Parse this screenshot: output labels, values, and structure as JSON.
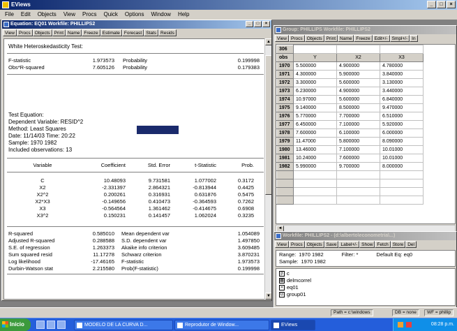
{
  "app": {
    "title": "EViews",
    "menu": [
      "File",
      "Edit",
      "Objects",
      "View",
      "Procs",
      "Quick",
      "Options",
      "Window",
      "Help"
    ]
  },
  "equation_window": {
    "title": "Equation: EQ01   Workfile: PHILLIPS2",
    "toolbar": [
      "View",
      "Procs",
      "Objects",
      "Print",
      "Name",
      "Freeze",
      "Estimate",
      "Forecast",
      "Stats",
      "Resids"
    ],
    "test_title": "White Heteroskedasticity Test:",
    "summary": [
      {
        "label": "F-statistic",
        "value": "1.973573",
        "plabel": "Probability",
        "pvalue": "0.199998"
      },
      {
        "label": "Obs*R-squared",
        "value": "7.605126",
        "plabel": "Probability",
        "pvalue": "0.179383"
      }
    ],
    "info": [
      "Test Equation:",
      "Dependent Variable: RESID^2",
      "Method: Least Squares",
      "Date: 11/14/03   Time: 20:22",
      "Sample: 1970 1982",
      "Included observations: 13"
    ],
    "coef_headers": [
      "Variable",
      "Coefficient",
      "Std. Error",
      "t-Statistic",
      "Prob."
    ],
    "coef_rows": [
      [
        "C",
        "10.48093",
        "9.731581",
        "1.077002",
        "0.3172"
      ],
      [
        "X2",
        "-2.331397",
        "2.864321",
        "-0.813944",
        "0.4425"
      ],
      [
        "X2^2",
        "0.200261",
        "0.316931",
        "0.631876",
        "0.5475"
      ],
      [
        "X2*X3",
        "-0.149656",
        "0.410473",
        "-0.364593",
        "0.7262"
      ],
      [
        "X3",
        "-0.564564",
        "1.361462",
        "-0.414675",
        "0.6908"
      ],
      [
        "X3^2",
        "0.150231",
        "0.141457",
        "1.062024",
        "0.3235"
      ]
    ],
    "stats": [
      [
        "R-squared",
        "0.585010",
        "Mean dependent var",
        "1.054089"
      ],
      [
        "Adjusted R-squared",
        "0.288588",
        "S.D. dependent var",
        "1.497850"
      ],
      [
        "S.E. of regression",
        "1.263373",
        "Akaike info criterion",
        "3.609485"
      ],
      [
        "Sum squared resid",
        "11.17278",
        "Schwarz criterion",
        "3.870231"
      ],
      [
        "Log likelihood",
        "-17.46165",
        "F-statistic",
        "1.973573"
      ],
      [
        "Durbin-Watson stat",
        "2.215580",
        "Prob(F-statistic)",
        "0.199998"
      ]
    ]
  },
  "group_window": {
    "title": "Group: PHILLIPS   Workfile: PHILLIPS2",
    "toolbar": [
      "View",
      "Procs",
      "Objects",
      "Print",
      "Name",
      "Freeze",
      "Edit+/-",
      "Smpl+/-",
      "In"
    ],
    "cell_ref": "306",
    "headers": [
      "obs",
      "Y",
      "X2",
      "X3"
    ],
    "rows": [
      [
        "1970",
        "5.500000",
        "4.900000",
        "4.780000"
      ],
      [
        "1971",
        "4.300000",
        "5.900000",
        "3.840000"
      ],
      [
        "1972",
        "3.300000",
        "5.600000",
        "3.130000"
      ],
      [
        "1973",
        "6.230000",
        "4.900000",
        "3.440000"
      ],
      [
        "1974",
        "10.97000",
        "5.600000",
        "6.840000"
      ],
      [
        "1975",
        "9.140000",
        "8.500000",
        "9.470000"
      ],
      [
        "1976",
        "5.770000",
        "7.700000",
        "6.510000"
      ],
      [
        "1977",
        "6.450000",
        "7.100000",
        "5.920000"
      ],
      [
        "1978",
        "7.600000",
        "6.100000",
        "6.000000"
      ],
      [
        "1979",
        "11.47000",
        "5.800000",
        "8.090000"
      ],
      [
        "1980",
        "13.46000",
        "7.100000",
        "10.01000"
      ],
      [
        "1981",
        "10.24000",
        "7.600000",
        "10.01000"
      ],
      [
        "1982",
        "5.990000",
        "9.700000",
        "8.000000"
      ]
    ]
  },
  "workfile_window": {
    "title": "Workfile: PHILLIPS2 - (d:\\alberto\\econometria\\...)",
    "toolbar": [
      "View",
      "Procs",
      "Objects",
      "Save",
      "Label+/-",
      "Show",
      "Fetch",
      "Store",
      "Del"
    ],
    "range_label": "Range:",
    "range_value": "1970 1982",
    "filter_label": "Filter: *",
    "default_eq": "Default Eq: eq0",
    "sample_label": "Sample:",
    "sample_value": "1970 1982",
    "objects": [
      "c",
      "delmcorrel",
      "eq01",
      "group01"
    ]
  },
  "statusbar": {
    "path": "Path = c:\\windows",
    "db": "DB = none",
    "wf": "WF = phillip"
  },
  "taskbar": {
    "start": "Início",
    "tasks": [
      "MODELO DE LA CURVA D...",
      "Reprodutor de Window...",
      "EViews"
    ],
    "clock": "08:28 p.m."
  }
}
